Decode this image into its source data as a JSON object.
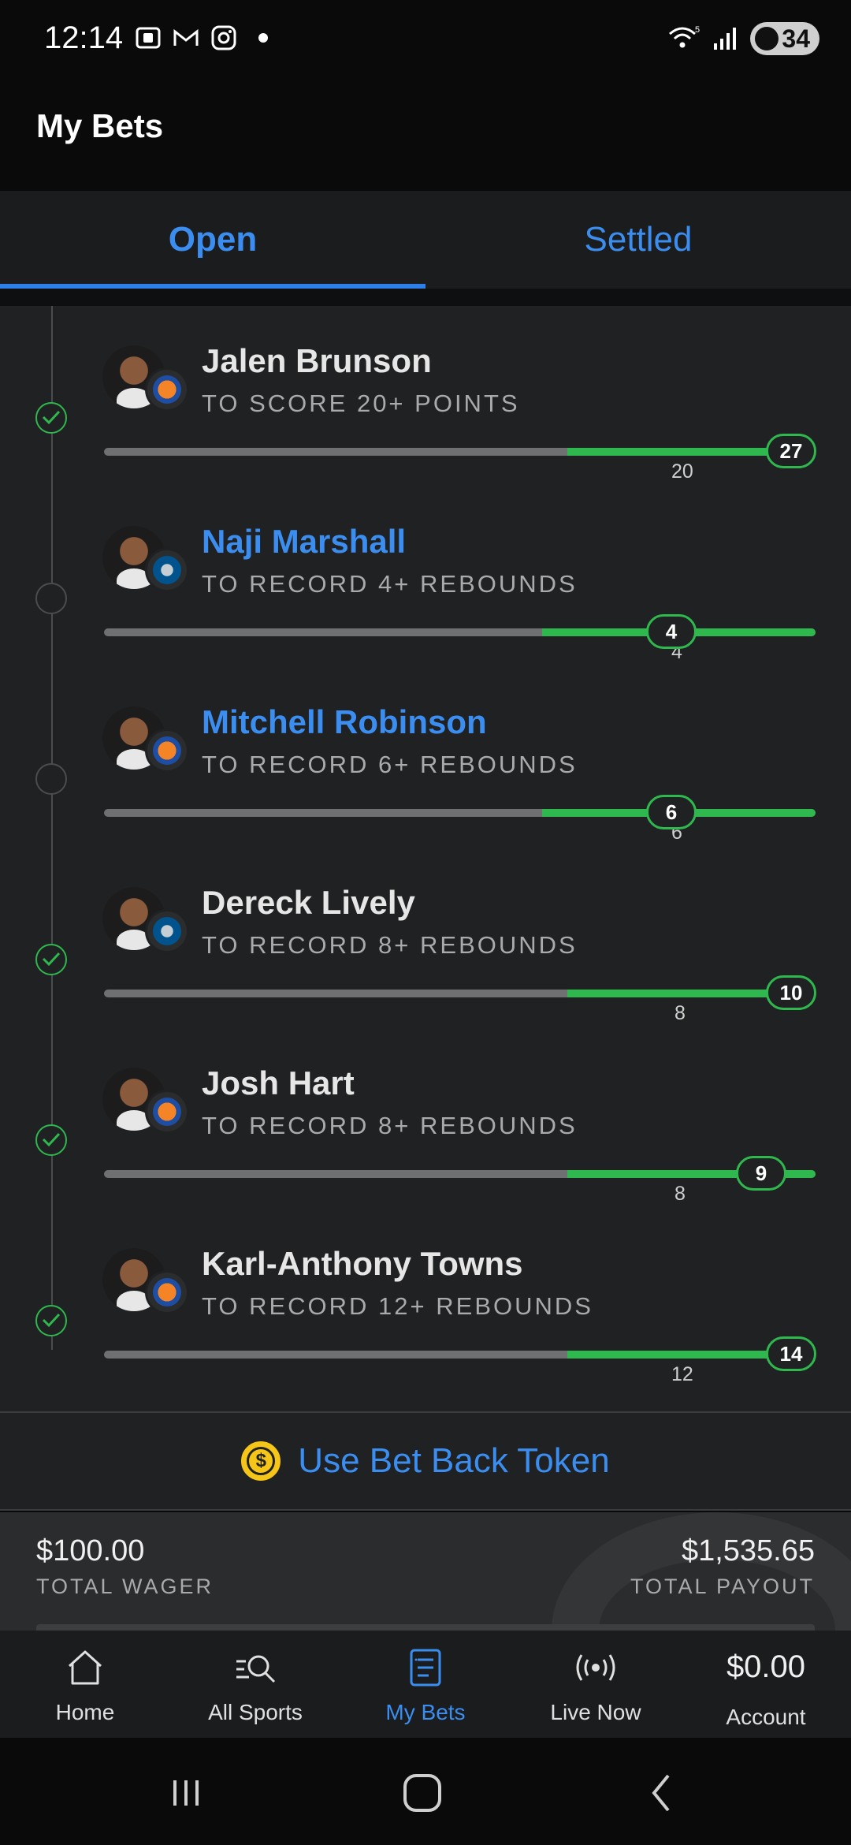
{
  "status_bar": {
    "time": "12:14",
    "battery": "34",
    "wifi_label": "5"
  },
  "header": {
    "title": "My Bets"
  },
  "tabs": [
    {
      "label": "Open",
      "active": true
    },
    {
      "label": "Settled",
      "active": false
    }
  ],
  "legs": [
    {
      "player": "Jalen Brunson",
      "market": "TO SCORE 20+ POINTS",
      "line": "20",
      "current": "27",
      "team_icon": "knicks-logo-icon",
      "status": "won",
      "highlight": false
    },
    {
      "player": "Naji Marshall",
      "market": "TO RECORD 4+ REBOUNDS",
      "line": "4",
      "current": "4",
      "team_icon": "mavericks-logo-icon",
      "status": "pending",
      "highlight": true
    },
    {
      "player": "Mitchell Robinson",
      "market": "TO RECORD 6+ REBOUNDS",
      "line": "6",
      "current": "6",
      "team_icon": "knicks-logo-icon",
      "status": "pending",
      "highlight": true
    },
    {
      "player": "Dereck Lively",
      "market": "TO RECORD 8+ REBOUNDS",
      "line": "8",
      "current": "10",
      "team_icon": "mavericks-logo-icon",
      "status": "won",
      "highlight": false
    },
    {
      "player": "Josh Hart",
      "market": "TO RECORD 8+ REBOUNDS",
      "line": "8",
      "current": "9",
      "team_icon": "knicks-logo-icon",
      "status": "won",
      "highlight": false
    },
    {
      "player": "Karl-Anthony Towns",
      "market": "TO RECORD 12+ REBOUNDS",
      "line": "12",
      "current": "14",
      "team_icon": "knicks-logo-icon",
      "status": "won",
      "highlight": false
    }
  ],
  "token": {
    "label": "Use Bet Back Token",
    "icon": "dollar-coin-icon"
  },
  "totals": {
    "wager_value": "$100.00",
    "wager_label": "TOTAL WAGER",
    "payout_value": "$1,535.65",
    "payout_label": "TOTAL PAYOUT"
  },
  "bottom_nav": [
    {
      "label": "Home",
      "icon": "home-icon",
      "active": false
    },
    {
      "label": "All Sports",
      "icon": "search-sports-icon",
      "active": false
    },
    {
      "label": "My Bets",
      "icon": "bet-slip-icon",
      "active": true
    },
    {
      "label": "Live Now",
      "icon": "live-broadcast-icon",
      "active": false
    },
    {
      "label": "Account",
      "icon": "account-balance",
      "active": false,
      "amount": "$0.00"
    }
  ],
  "colors": {
    "accent": "#3b8ef0",
    "success": "#2fb84d",
    "background": "#1f2123"
  }
}
